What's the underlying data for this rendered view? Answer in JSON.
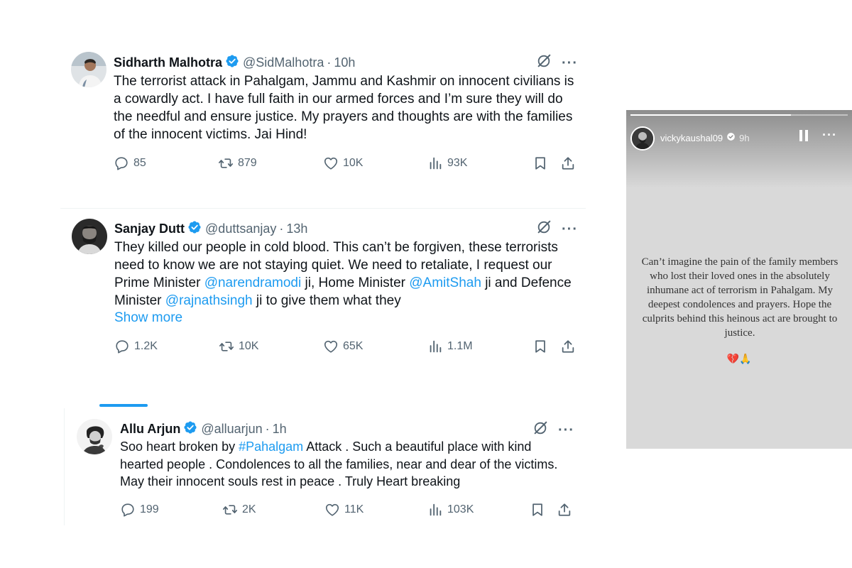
{
  "tweets": [
    {
      "name": "Sidharth Malhotra",
      "handle": "@SidMalhotra",
      "separator": "·",
      "time": "10h",
      "text": "The terrorist attack in Pahalgam, Jammu and Kashmir on innocent civilians is a cowardly act. I have full faith in our armed forces and I’m sure they will do the needful and ensure justice. My prayers and thoughts are with the families of the innocent victims. Jai Hind!",
      "replies": "85",
      "reposts": "879",
      "likes": "10K",
      "views": "93K"
    },
    {
      "name": "Sanjay Dutt",
      "handle": "@duttsanjay",
      "separator": "·",
      "time": "13h",
      "text_segments": [
        "They killed our people in cold blood. This can’t be forgiven, these terrorists need to know we are not staying quiet. We need to retaliate, I request our Prime Minister ",
        "@narendramodi",
        " ji, Home Minister ",
        "@AmitShah",
        " ji and Defence Minister ",
        "@rajnathsingh",
        " ji to give them what they"
      ],
      "show_more": "Show more",
      "replies": "1.2K",
      "reposts": "10K",
      "likes": "65K",
      "views": "1.1M"
    },
    {
      "name": "Allu Arjun",
      "handle": "@alluarjun",
      "separator": "·",
      "time": "1h",
      "text_segments": [
        "Soo heart broken by ",
        "#Pahalgam",
        " Attack . Such a beautiful place with kind hearted people . Condolences to all the families, near and dear of the victims. May their innocent souls rest in peace . Truly Heart breaking"
      ],
      "replies": "199",
      "reposts": "2K",
      "likes": "11K",
      "views": "103K"
    }
  ],
  "story": {
    "username": "vickykaushal09",
    "time": "9h",
    "progress": 0.74,
    "text": "Can’t imagine the pain of the family members who lost their loved ones in the absolutely inhumane act of terrorism in Pahalgam. My deepest condolences and prayers. Hope the culprits behind this heinous act are brought to justice.",
    "emoji": "💔🙏"
  },
  "colors": {
    "accent": "#1d9bf0",
    "secondary_text": "#536471",
    "primary_text": "#0f1419",
    "story_background": "#d9d9d9"
  },
  "icons": [
    "verified-badge-icon",
    "grok-icon",
    "more-icon",
    "reply-icon",
    "repost-icon",
    "like-icon",
    "views-icon",
    "bookmark-icon",
    "share-icon",
    "pause-icon"
  ]
}
